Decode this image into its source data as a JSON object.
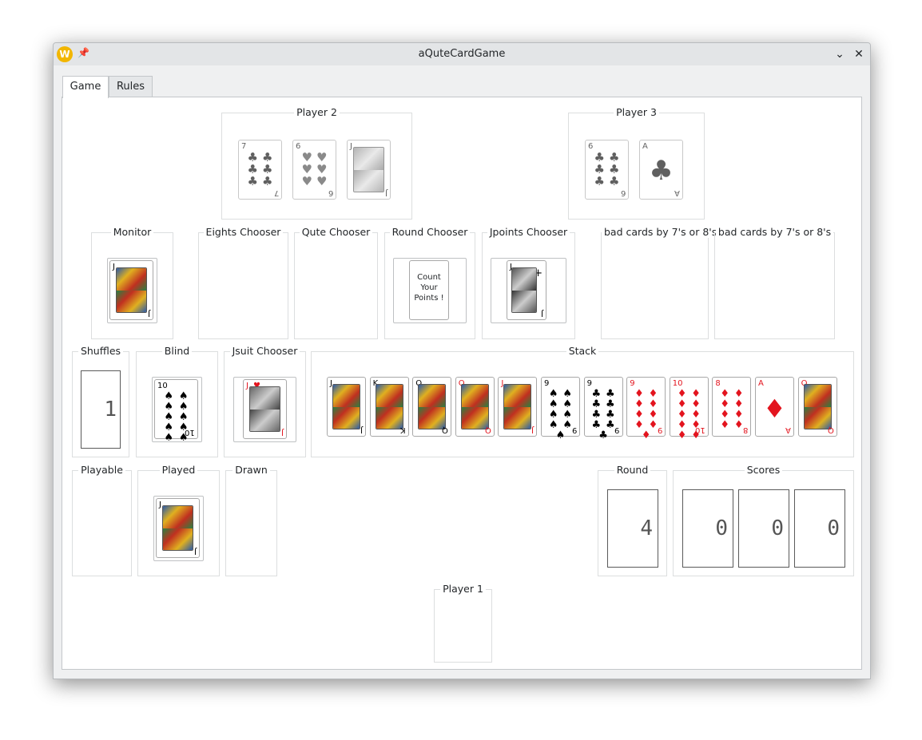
{
  "window": {
    "title": "aQuteCardGame"
  },
  "titlebar": {
    "app_icon": "W",
    "pin_icon": "📌",
    "minimize_icon": "⌄",
    "close_icon": "✕"
  },
  "tabs": [
    {
      "label": "Game"
    },
    {
      "label": "Rules"
    }
  ],
  "groups": {
    "player2": "Player 2",
    "player3": "Player 3",
    "monitor": "Monitor",
    "eights": "Eights Chooser",
    "qute": "Qute Chooser",
    "round_chooser": "Round Chooser",
    "jpoints": "Jpoints Chooser",
    "bad1": "bad cards by 7's or 8's",
    "bad2": "bad cards by 7's or 8's",
    "shuffles": "Shuffles",
    "blind": "Blind",
    "jsuit": "Jsuit Chooser",
    "stack": "Stack",
    "playable": "Playable",
    "played": "Played",
    "drawn": "Drawn",
    "round": "Round",
    "scores": "Scores",
    "player1": "Player 1"
  },
  "cards": {
    "player2": [
      {
        "rank": "7",
        "suit": "♣",
        "color": "#000000"
      },
      {
        "rank": "6",
        "suit": "♥",
        "color": "#000000"
      },
      {
        "rank": "J",
        "suit": "♦",
        "color": "#000000"
      }
    ],
    "player3": [
      {
        "rank": "6",
        "suit": "♣",
        "color": "#000000"
      },
      {
        "rank": "A",
        "suit": "♣",
        "color": "#000000"
      }
    ],
    "monitor": {
      "rank": "J",
      "suit": "♠"
    },
    "jpoints": {
      "rank": "J",
      "suit": "+"
    },
    "blind": {
      "rank": "10",
      "suit": "♠"
    },
    "jsuit": {
      "rank": "J",
      "suit": "♥"
    },
    "played": {
      "rank": "J",
      "suit": "♠"
    },
    "stack": [
      {
        "rank": "J",
        "suit": "♣"
      },
      {
        "rank": "K",
        "suit": "♣"
      },
      {
        "rank": "Q",
        "suit": "♠"
      },
      {
        "rank": "Q",
        "suit": "♥"
      },
      {
        "rank": "J",
        "suit": "♥"
      },
      {
        "rank": "9",
        "suit": "♠"
      },
      {
        "rank": "9",
        "suit": "♣"
      },
      {
        "rank": "9",
        "suit": "♦"
      },
      {
        "rank": "10",
        "suit": "♦"
      },
      {
        "rank": "8",
        "suit": "♦"
      },
      {
        "rank": "A",
        "suit": "♦"
      },
      {
        "rank": "Q",
        "suit": "♦"
      }
    ]
  },
  "round_chooser": {
    "line1": "Count",
    "line2": "Your",
    "line3": "Points !"
  },
  "shuffles_value": "1",
  "round_value": "4",
  "scores": [
    "0",
    "0",
    "0"
  ]
}
